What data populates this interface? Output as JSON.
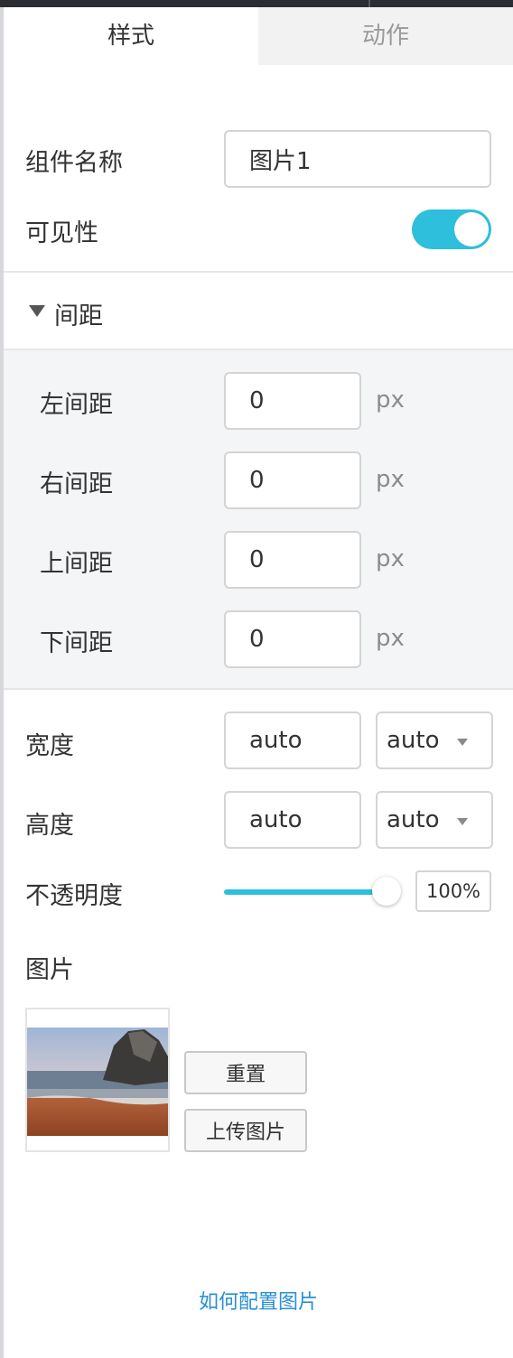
{
  "tabs": {
    "style": "样式",
    "action": "动作"
  },
  "component_name": {
    "label": "组件名称",
    "value": "图片1"
  },
  "visibility": {
    "label": "可见性",
    "on": true
  },
  "spacing": {
    "title": "间距",
    "left": {
      "label": "左间距",
      "value": "0",
      "unit": "px"
    },
    "right": {
      "label": "右间距",
      "value": "0",
      "unit": "px"
    },
    "top": {
      "label": "上间距",
      "value": "0",
      "unit": "px"
    },
    "bottom": {
      "label": "下间距",
      "value": "0",
      "unit": "px"
    }
  },
  "width": {
    "label": "宽度",
    "value": "auto",
    "unit_select": "auto"
  },
  "height": {
    "label": "高度",
    "value": "auto",
    "unit_select": "auto"
  },
  "opacity": {
    "label": "不透明度",
    "value": "100%",
    "fraction": 1.0
  },
  "image": {
    "label": "图片",
    "reset_button": "重置",
    "upload_button": "上传图片"
  },
  "help_link": "如何配置图片",
  "colors": {
    "accent": "#2dbfdc",
    "link": "#2a8fd4",
    "panel_bg": "#f4f5f7"
  },
  "icons": {
    "section_toggle": "triangle-down-icon",
    "select_arrow": "chevron-down-icon"
  }
}
